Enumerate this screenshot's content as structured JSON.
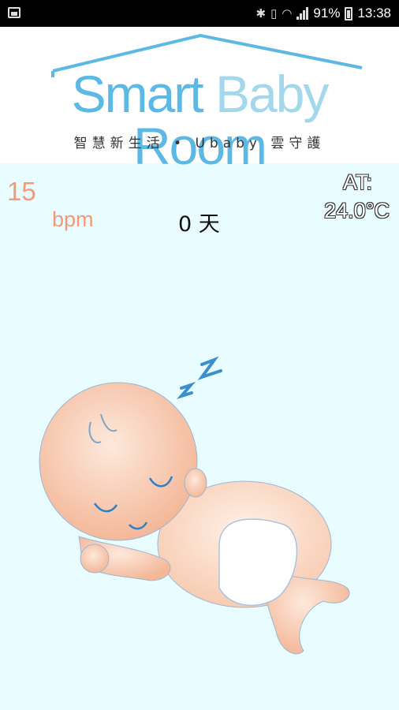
{
  "status_bar": {
    "battery_percent": "91%",
    "time": "13:38"
  },
  "logo": {
    "word1": "Smart",
    "word2": "Baby",
    "word3": "Room",
    "tagline": "智慧新生活 • Ubaby 雲守護"
  },
  "monitor": {
    "bpm_value": "15",
    "bpm_unit": "bpm",
    "days": "0 天",
    "temp_label": "AT:",
    "temp_value": "24.0°C"
  },
  "colors": {
    "accent_blue": "#5cb8e4",
    "bpm_orange": "#f39b78",
    "background": "#e9fcff"
  }
}
